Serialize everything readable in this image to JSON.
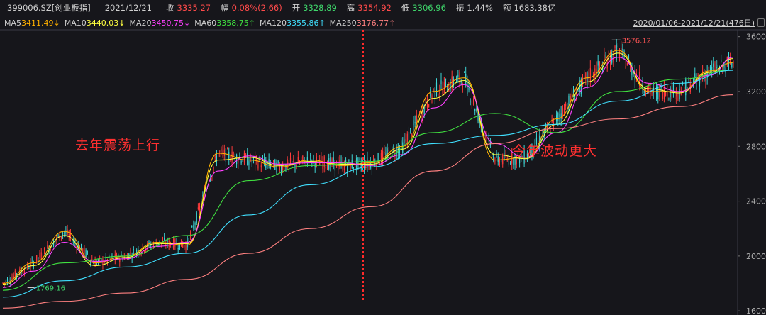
{
  "header": {
    "code": "399006.SZ[创业板指]",
    "date": "2021/12/21",
    "close_label": "收",
    "close_value": "3335.27",
    "change_label": "幅",
    "change_value": "0.08%(2.66)",
    "open_label": "开",
    "open_value": "3328.89",
    "high_label": "高",
    "high_value": "3354.92",
    "low_label": "低",
    "low_value": "3306.96",
    "amp_label": "振",
    "amp_value": "1.44%",
    "amount_label": "额",
    "amount_value": "1683.38亿"
  },
  "ma_legend": [
    {
      "name": "MA5",
      "value": "3411.49↓",
      "color": "#ffb000"
    },
    {
      "name": "MA10",
      "value": "3440.03↓",
      "color": "#ffff40"
    },
    {
      "name": "MA20",
      "value": "3450.75↓",
      "color": "#ff40ff"
    },
    {
      "name": "MA60",
      "value": "3358.75↑",
      "color": "#40e040"
    },
    {
      "name": "MA120",
      "value": "3355.86↑",
      "color": "#40e0ff"
    },
    {
      "name": "MA250",
      "value": "3176.77↑",
      "color": "#ff8080"
    }
  ],
  "date_range": "2020/01/06-2021/12/21(476日)",
  "annotations": {
    "left_caption": "去年震荡上行",
    "right_caption": "今年波动更大",
    "high_mark": "3576.12",
    "low_mark": "1769.16"
  },
  "chart_data": {
    "type": "line",
    "title": "",
    "ylim": [
      1570,
      3650
    ],
    "yticks": [
      "3600",
      "3200",
      "2800",
      "2400",
      "2000",
      "1600"
    ],
    "ytick_values": [
      3600,
      3200,
      2800,
      2400,
      2000,
      1600
    ],
    "x_range": [
      "2020/01/06",
      "2021/12/21"
    ],
    "series": [
      {
        "name": "MA5",
        "color": "#ffb000",
        "x": [
          0,
          20,
          40,
          60,
          80,
          100,
          120,
          140,
          160,
          180,
          200,
          220,
          240,
          260,
          280,
          300,
          320,
          340,
          360,
          380,
          400,
          420,
          440,
          460,
          475
        ],
        "values": [
          1800,
          1950,
          2180,
          1950,
          2000,
          2100,
          2080,
          2750,
          2700,
          2650,
          2700,
          2660,
          2680,
          2800,
          3200,
          3300,
          2700,
          2720,
          3000,
          3300,
          3500,
          3200,
          3200,
          3350,
          3411
        ]
      },
      {
        "name": "MA10",
        "color": "#ffff40",
        "x": [
          0,
          20,
          40,
          60,
          80,
          100,
          120,
          140,
          160,
          180,
          200,
          220,
          240,
          260,
          280,
          300,
          320,
          340,
          360,
          380,
          400,
          420,
          440,
          460,
          475
        ],
        "values": [
          1790,
          1930,
          2150,
          1930,
          1990,
          2090,
          2090,
          2700,
          2720,
          2660,
          2690,
          2670,
          2670,
          2780,
          3150,
          3280,
          2740,
          2710,
          2960,
          3270,
          3480,
          3220,
          3190,
          3340,
          3440
        ]
      },
      {
        "name": "MA20",
        "color": "#ff40ff",
        "x": [
          0,
          20,
          40,
          60,
          80,
          100,
          120,
          140,
          160,
          180,
          200,
          220,
          240,
          260,
          280,
          300,
          320,
          340,
          360,
          380,
          400,
          420,
          440,
          460,
          475
        ],
        "values": [
          1770,
          1890,
          2100,
          1960,
          1980,
          2070,
          2100,
          2620,
          2730,
          2670,
          2680,
          2680,
          2660,
          2740,
          3080,
          3250,
          2820,
          2720,
          2900,
          3230,
          3450,
          3260,
          3200,
          3320,
          3450
        ]
      },
      {
        "name": "MA60",
        "color": "#40e040",
        "x": [
          0,
          40,
          80,
          120,
          160,
          200,
          240,
          280,
          320,
          360,
          400,
          440,
          475
        ],
        "values": [
          1750,
          1950,
          2000,
          2150,
          2550,
          2660,
          2690,
          2900,
          3040,
          2900,
          3200,
          3290,
          3358
        ]
      },
      {
        "name": "MA120",
        "color": "#40e0ff",
        "x": [
          0,
          40,
          80,
          120,
          160,
          200,
          240,
          280,
          320,
          360,
          400,
          440,
          475
        ],
        "values": [
          1700,
          1820,
          1920,
          2020,
          2300,
          2520,
          2650,
          2820,
          2880,
          2960,
          3130,
          3260,
          3355
        ]
      },
      {
        "name": "MA250",
        "color": "#ff8080",
        "x": [
          0,
          40,
          80,
          120,
          160,
          200,
          240,
          280,
          320,
          360,
          400,
          440,
          475
        ],
        "values": [
          1620,
          1670,
          1730,
          1830,
          2020,
          2200,
          2360,
          2620,
          2820,
          2930,
          3000,
          3090,
          3176
        ]
      }
    ]
  }
}
